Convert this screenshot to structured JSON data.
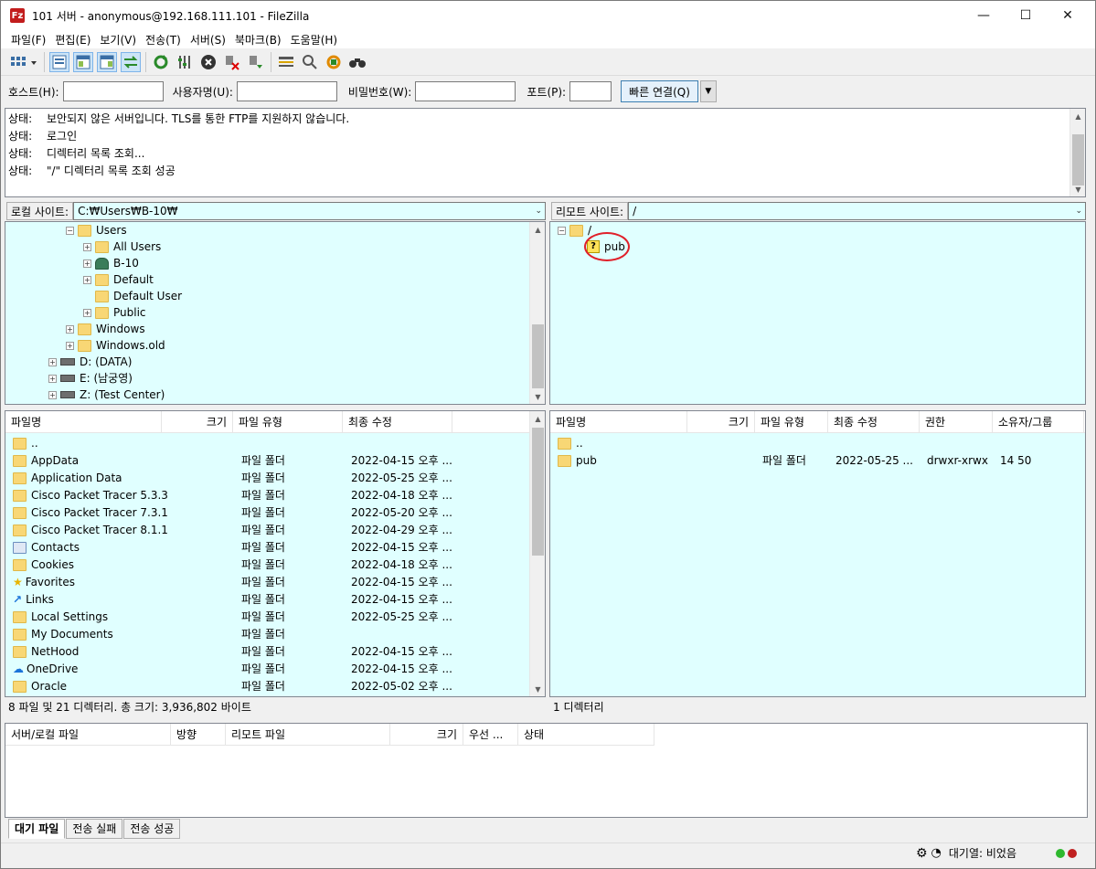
{
  "titlebar": {
    "icon": "Fz",
    "title": "101 서버 - anonymous@192.168.111.101 - FileZilla",
    "minimize": "—",
    "maximize": "☐",
    "close": "✕"
  },
  "menu": [
    "파일(F)",
    "편집(E)",
    "보기(V)",
    "전송(T)",
    "서버(S)",
    "북마크(B)",
    "도움말(H)"
  ],
  "quickconnect": {
    "host_label": "호스트(H):",
    "user_label": "사용자명(U):",
    "pass_label": "비밀번호(W):",
    "port_label": "포트(P):",
    "button": "빠른 연결(Q)",
    "host": "",
    "user": "",
    "pass": "",
    "port": ""
  },
  "log": [
    {
      "k": "상태:",
      "v": "보안되지 않은 서버입니다. TLS를 통한 FTP를 지원하지 않습니다."
    },
    {
      "k": "상태:",
      "v": "로그인"
    },
    {
      "k": "상태:",
      "v": "디렉터리 목록 조회..."
    },
    {
      "k": "상태:",
      "v": "\"/\" 디렉터리 목록 조회 성공"
    }
  ],
  "local": {
    "label": "로컬 사이트:",
    "path": "C:₩Users₩B-10₩",
    "tree": [
      {
        "name": "Users",
        "indent": 2,
        "pm": "⊟",
        "icon": "folder"
      },
      {
        "name": "All Users",
        "indent": 3,
        "pm": "⊞",
        "icon": "folder"
      },
      {
        "name": "B-10",
        "indent": 3,
        "pm": "⊞",
        "icon": "user"
      },
      {
        "name": "Default",
        "indent": 3,
        "pm": "⊞",
        "icon": "folder"
      },
      {
        "name": "Default User",
        "indent": 3,
        "pm": "",
        "icon": "folder"
      },
      {
        "name": "Public",
        "indent": 3,
        "pm": "⊞",
        "icon": "folder"
      },
      {
        "name": "Windows",
        "indent": 2,
        "pm": "⊞",
        "icon": "folder"
      },
      {
        "name": "Windows.old",
        "indent": 2,
        "pm": "⊞",
        "icon": "folder"
      },
      {
        "name": "D: (DATA)",
        "indent": 1,
        "pm": "⊞",
        "icon": "drive"
      },
      {
        "name": "E: (남궁영)",
        "indent": 1,
        "pm": "⊞",
        "icon": "drive"
      },
      {
        "name": "Z: (Test Center)",
        "indent": 1,
        "pm": "⊞",
        "icon": "drive"
      }
    ],
    "columns": [
      "파일명",
      "크기",
      "파일 유형",
      "최종 수정"
    ],
    "files": [
      {
        "name": "..",
        "type": "",
        "date": ""
      },
      {
        "name": "AppData",
        "type": "파일 폴더",
        "date": "2022-04-15 오후 ..."
      },
      {
        "name": "Application Data",
        "type": "파일 폴더",
        "date": "2022-05-25 오후 ..."
      },
      {
        "name": "Cisco Packet Tracer 5.3.3",
        "type": "파일 폴더",
        "date": "2022-04-18 오후 ..."
      },
      {
        "name": "Cisco Packet Tracer 7.3.1",
        "type": "파일 폴더",
        "date": "2022-05-20 오후 ..."
      },
      {
        "name": "Cisco Packet Tracer 8.1.1",
        "type": "파일 폴더",
        "date": "2022-04-29 오후 ..."
      },
      {
        "name": "Contacts",
        "type": "파일 폴더",
        "date": "2022-04-15 오후 ..."
      },
      {
        "name": "Cookies",
        "type": "파일 폴더",
        "date": "2022-04-18 오후 ..."
      },
      {
        "name": "Favorites",
        "type": "파일 폴더",
        "date": "2022-04-15 오후 ..."
      },
      {
        "name": "Links",
        "type": "파일 폴더",
        "date": "2022-04-15 오후 ..."
      },
      {
        "name": "Local Settings",
        "type": "파일 폴더",
        "date": "2022-05-25 오후 ..."
      },
      {
        "name": "My Documents",
        "type": "파일 폴더",
        "date": ""
      },
      {
        "name": "NetHood",
        "type": "파일 폴더",
        "date": "2022-04-15 오후 ..."
      },
      {
        "name": "OneDrive",
        "type": "파일 폴더",
        "date": "2022-04-15 오후 ..."
      },
      {
        "name": "Oracle",
        "type": "파일 폴더",
        "date": "2022-05-02 오후 ..."
      }
    ],
    "status": "8 파일 및 21 디렉터리. 총 크기: 3,936,802 바이트"
  },
  "remote": {
    "label": "리모트 사이트:",
    "path": "/",
    "tree": [
      {
        "name": "/",
        "indent": 0,
        "pm": "⊟",
        "icon": "folder"
      },
      {
        "name": "pub",
        "indent": 1,
        "pm": "",
        "icon": "question"
      }
    ],
    "columns": [
      "파일명",
      "크기",
      "파일 유형",
      "최종 수정",
      "권한",
      "소유자/그룹"
    ],
    "files": [
      {
        "name": "..",
        "size": "",
        "type": "",
        "date": "",
        "perm": "",
        "owner": ""
      },
      {
        "name": "pub",
        "size": "",
        "type": "파일 폴더",
        "date": "2022-05-25 ...",
        "perm": "drwxr-xrwx",
        "owner": "14 50"
      }
    ],
    "status": "1 디렉터리"
  },
  "queue": {
    "columns": [
      "서버/로컬 파일",
      "방향",
      "리모트 파일",
      "크기",
      "우선 ...",
      "상태"
    ],
    "tabs": [
      "대기 파일",
      "전송 실패",
      "전송 성공"
    ]
  },
  "statusbar": {
    "queue_text": "대기열: 비었음"
  }
}
